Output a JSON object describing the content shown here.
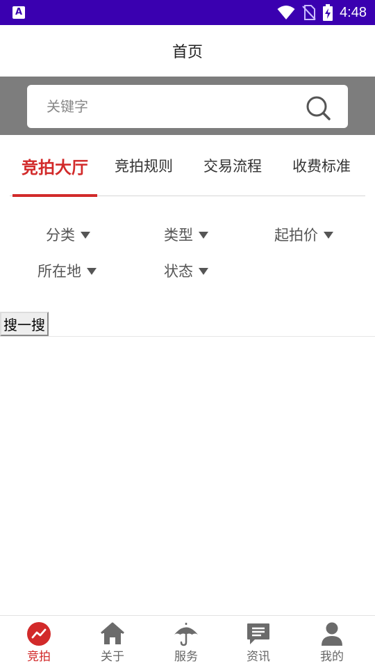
{
  "status_bar": {
    "time": "4:48",
    "app_icon": "A"
  },
  "header": {
    "title": "首页"
  },
  "search": {
    "placeholder": "关键字",
    "icon": "search-icon"
  },
  "tabs": [
    {
      "label": "竞拍大厅",
      "active": true
    },
    {
      "label": "竞拍规则",
      "active": false
    },
    {
      "label": "交易流程",
      "active": false
    },
    {
      "label": "收费标准",
      "active": false
    }
  ],
  "filters": [
    {
      "label": "分类"
    },
    {
      "label": "类型"
    },
    {
      "label": "起拍价"
    },
    {
      "label": "所在地"
    },
    {
      "label": "状态"
    }
  ],
  "search_button": {
    "label": "搜一搜"
  },
  "bottom_nav": [
    {
      "label": "竞拍",
      "icon": "trend-icon",
      "active": true
    },
    {
      "label": "关于",
      "icon": "home-icon",
      "active": false
    },
    {
      "label": "服务",
      "icon": "umbrella-icon",
      "active": false
    },
    {
      "label": "资讯",
      "icon": "message-icon",
      "active": false
    },
    {
      "label": "我的",
      "icon": "user-icon",
      "active": false
    }
  ],
  "colors": {
    "accent": "#d22a2a",
    "status_bar": "#3a00b0",
    "search_band": "#7d7d7d"
  }
}
